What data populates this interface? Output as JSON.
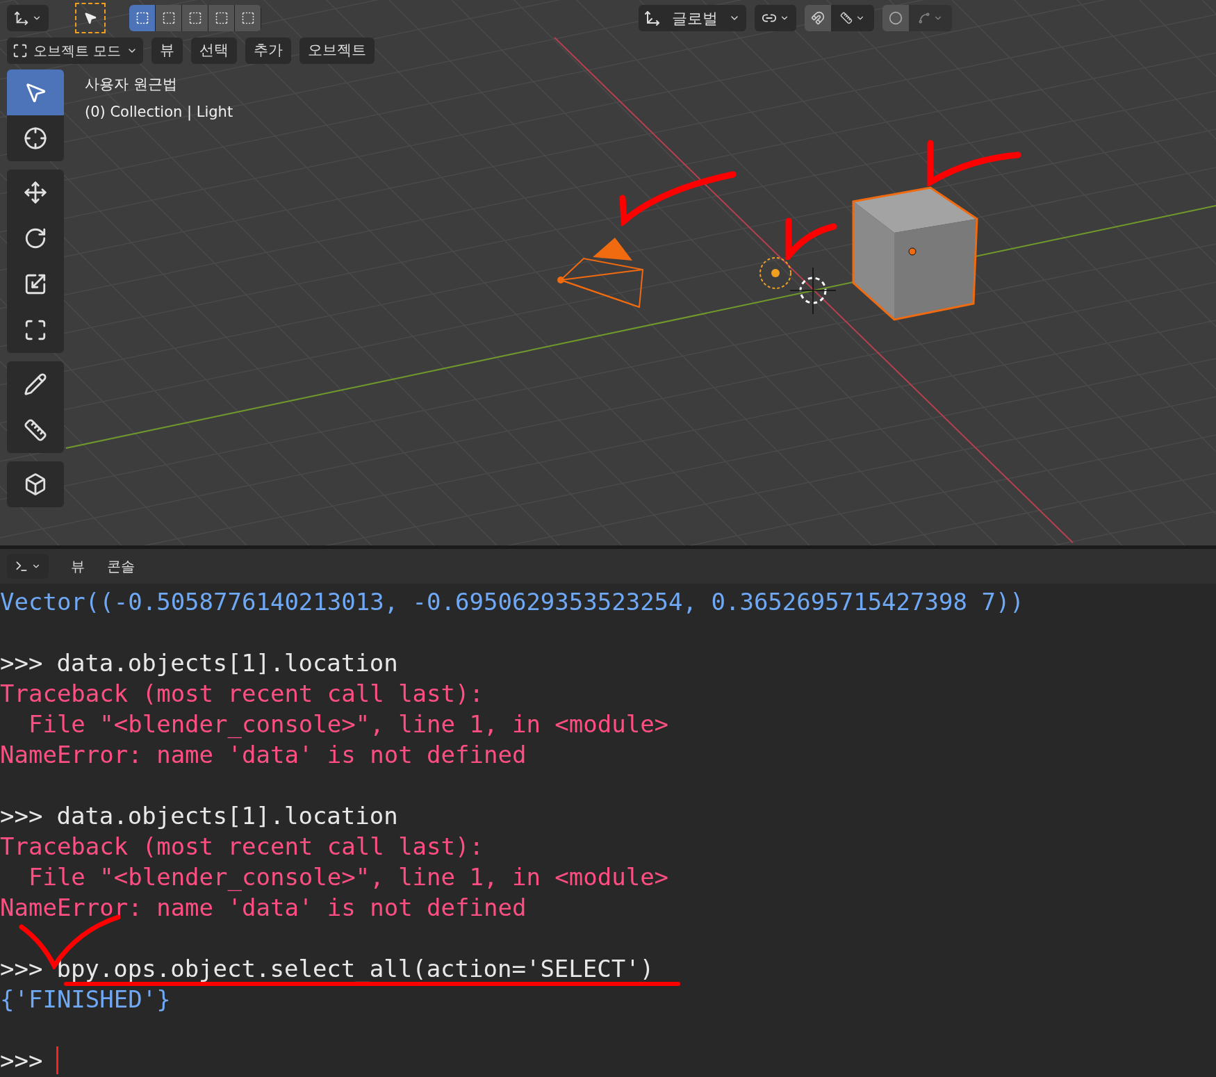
{
  "header": {
    "select_modes": [
      {
        "selected": true
      },
      {
        "selected": false
      },
      {
        "selected": false
      },
      {
        "selected": false
      },
      {
        "selected": false
      }
    ],
    "orientation": "글로벌"
  },
  "viewport_menu": {
    "mode": "오브젝트 모드",
    "items": [
      "뷰",
      "선택",
      "추가",
      "오브젝트"
    ]
  },
  "overlay": {
    "view_name": "사용자 원근법",
    "collection": "(0) Collection | Light"
  },
  "tool_groups": [
    [
      {
        "kind": "select",
        "selected": true
      },
      {
        "kind": "cursor",
        "selected": false
      }
    ],
    [
      {
        "kind": "move",
        "selected": false
      },
      {
        "kind": "rotate",
        "selected": false
      },
      {
        "kind": "scale",
        "selected": false
      },
      {
        "kind": "transform",
        "selected": false
      }
    ],
    [
      {
        "kind": "annotate",
        "selected": false
      },
      {
        "kind": "measure",
        "selected": false
      }
    ],
    [
      {
        "kind": "add_cube",
        "selected": false
      }
    ]
  ],
  "console": {
    "menus": [
      "뷰",
      "콘솔"
    ],
    "lines": [
      {
        "kind": "output",
        "text": "Vector((-0.5058776140213013, -0.6950629353523254, 0.3652695715427398 7))"
      },
      {
        "kind": "blank"
      },
      {
        "kind": "input",
        "prompt": ">>>",
        "text": "data.objects[1].location"
      },
      {
        "kind": "error",
        "text": "Traceback (most recent call last):"
      },
      {
        "kind": "error",
        "text": "  File \"<blender_console>\", line 1, in <module>"
      },
      {
        "kind": "error",
        "text": "NameError: name 'data' is not defined"
      },
      {
        "kind": "blank"
      },
      {
        "kind": "input",
        "prompt": ">>>",
        "text": "data.objects[1].location"
      },
      {
        "kind": "error",
        "text": "Traceback (most recent call last):"
      },
      {
        "kind": "error",
        "text": "  File \"<blender_console>\", line 1, in <module>"
      },
      {
        "kind": "error",
        "text": "NameError: name 'data' is not defined"
      },
      {
        "kind": "blank"
      },
      {
        "kind": "input",
        "prompt": ">>>",
        "text": "bpy.ops.object.select_all(action='SELECT')"
      },
      {
        "kind": "output",
        "text": "{'FINISHED'}"
      },
      {
        "kind": "blank"
      },
      {
        "kind": "prompt",
        "prompt": ">>>"
      }
    ]
  }
}
